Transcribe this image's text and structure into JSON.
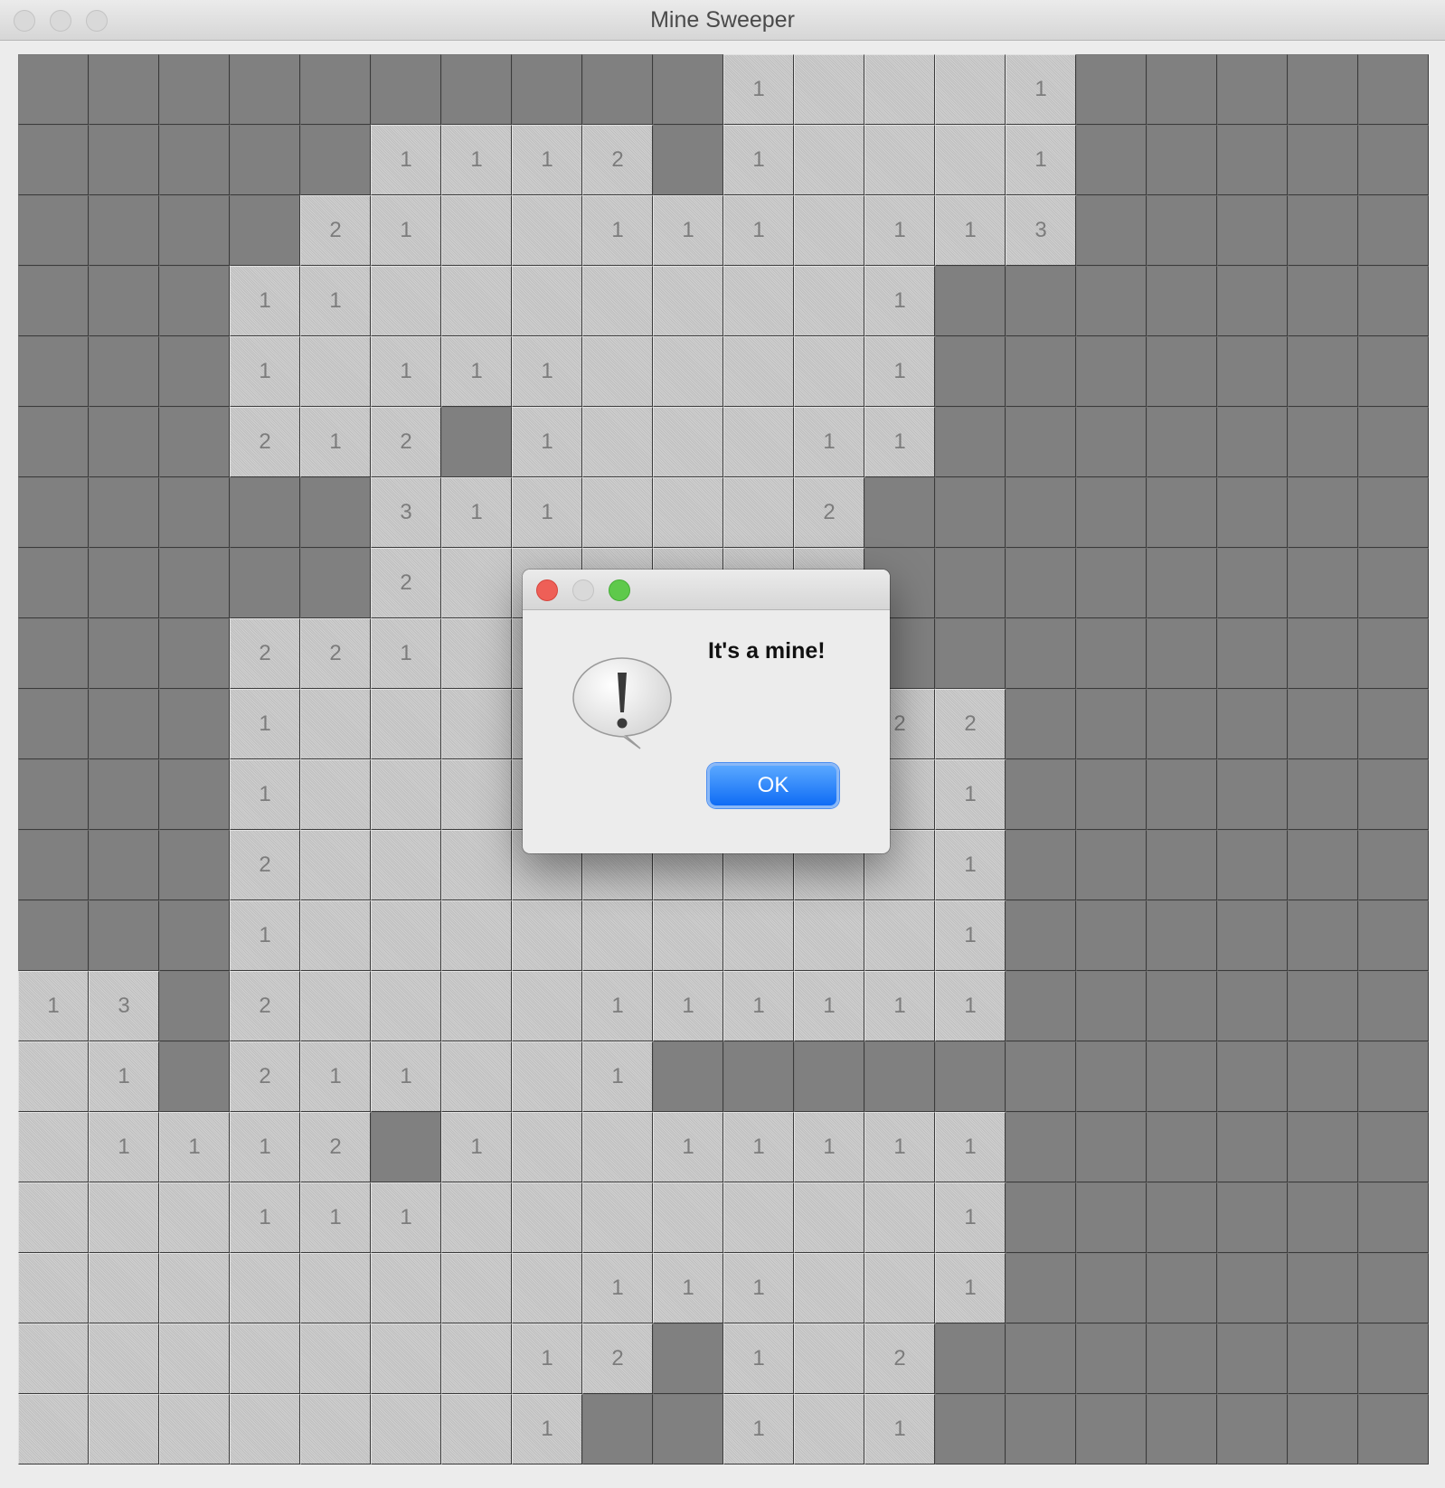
{
  "window": {
    "title": "Mine Sweeper"
  },
  "board": {
    "columns": 20,
    "rows": 20,
    "legend": "H = unrevealed, . = revealed empty, digit = revealed number",
    "grid": [
      "HHHHHHHHHH1...1HHHHH",
      "HHHHH1112H1...1HHHHH",
      "HHHH21..111.113HHHHH",
      "HHH11.......1HHHHHHH",
      "HHH1.111....1HHHHHHH",
      "HHH212H1...11HHHHHHH",
      "HHHHH311...2HHHHHHHH",
      "HHHHH2......HHHHHHHH",
      "HHH221......HHHHHHHH",
      "HHH1........22HHHHHH",
      "HHH1.........1HHHHHH",
      "HHH2.........1HHHHHH",
      "HHH1.........1HHHHHH",
      "13H2....111111HHHHHH",
      ".1H211..1HHHHHHHHHHH",
      ".1112H1..11111HHHHHH",
      "...111.......1HHHHHH",
      "........111..1HHHHHH",
      ".......12H1.2HHHHHHH",
      ".......1HH1.1HHHHHHH"
    ]
  },
  "dialog": {
    "icon": "alert-speech-bubble-icon",
    "message": "It's a mine!",
    "ok_label": "OK"
  },
  "colors": {
    "hidden_cell": "#808080",
    "revealed_cell": "#c6c6c6",
    "number_text": "#7c7c7c",
    "ok_button": "#0f6cf5"
  }
}
